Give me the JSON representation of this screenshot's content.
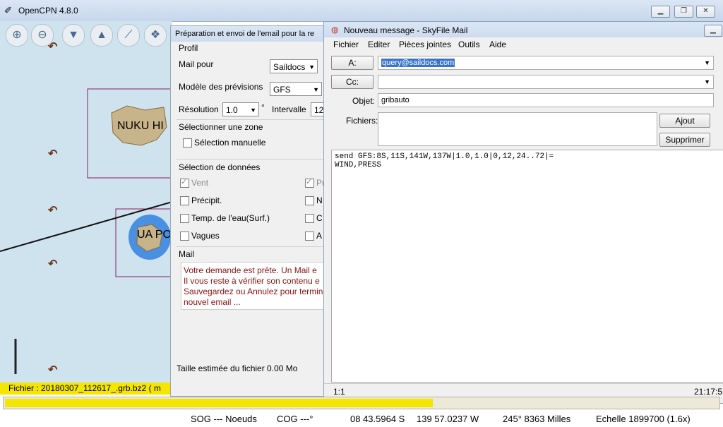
{
  "main_window": {
    "title": "OpenCPN 4.8.0"
  },
  "map": {
    "label1": "NUKU HI",
    "label2": "UA PO",
    "file_label": "Fichier : 20180307_112617_.grb.bz2 ( m"
  },
  "grib_dialog": {
    "title": "Préparation et envoi de l'email pour la re",
    "profile_section": "Profil",
    "mail_for_label": "Mail pour",
    "mail_for_value": "Saildocs",
    "model_label": "Modèle des prévisions",
    "model_value": "GFS",
    "resolution_label": "Résolution",
    "resolution_value": "1.0",
    "resolution_unit": "°",
    "interval_label": "Intervalle",
    "interval_value": "12",
    "zone_section": "Sélectionner une zone",
    "manual_selection": "Sélection manuelle",
    "data_section": "Sélection de données",
    "data_left": [
      "Vent",
      "Précipit.",
      "Temp. de l'eau(Surf.)",
      "Vagues"
    ],
    "data_right": [
      "Pr",
      "N",
      "C",
      "A"
    ],
    "mail_section": "Mail",
    "mail_message": [
      "Votre demande est prête. Un Mail e",
      "Il vous reste à vérifier son contenu e",
      "Sauvegardez ou Annulez pour termin",
      "nouvel email ..."
    ],
    "file_size": "Taille estimée du fichier 0.00 Mo"
  },
  "skyfile": {
    "title": "Nouveau message - SkyFile Mail",
    "menu": [
      "Fichier",
      "Editer",
      "Pièces jointes",
      "Outils",
      "Aide"
    ],
    "to_button": "A:",
    "to_value": "query@saildocs.com",
    "cc_button": "Cc:",
    "cc_value": "",
    "subject_label": "Objet:",
    "subject_value": "gribauto",
    "files_label": "Fichiers:",
    "add_button": "Ajout",
    "delete_button": "Supprimer",
    "body_lines": [
      "send GFS:8S,11S,141W,137W|1.0,1.0|0,12,24..72|=",
      "WIND,PRESS"
    ],
    "cursor_pos": "1:1",
    "clock": "21:17:5"
  },
  "statusbar": {
    "sog": "SOG --- Noeuds",
    "cog": "COG ---°",
    "lat": "08 43.5964 S",
    "lon": "139 57.0237 W",
    "brg": "245°  8363 Milles",
    "scale": "Echelle 1899700 (1.6x)"
  },
  "progress": {
    "fraction": 0.6
  }
}
